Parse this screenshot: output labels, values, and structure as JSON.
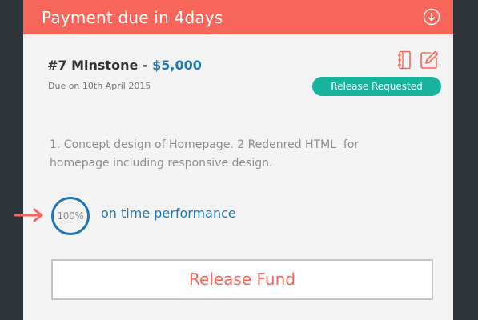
{
  "header": {
    "title": "Payment due in 4days",
    "icon": "download-circle-icon"
  },
  "milestone": {
    "name": "#7 Minstone",
    "separator": " - ",
    "amount": "$5,000",
    "due": "Due on 10th April 2015",
    "status": "Release Requested"
  },
  "icons": {
    "notebook": "notebook-icon",
    "edit": "edit-icon"
  },
  "description": "1. Concept design of Homepage. 2 Redenred HTML  for\nhomepage including responsive design.",
  "performance": {
    "value": "100%",
    "label": "on time performance"
  },
  "actions": {
    "release_label": "Release Fund"
  },
  "colors": {
    "header": "#f8665b",
    "accent_blue": "#2277b1",
    "status_badge": "#18b39c",
    "card_background": "#f3f3f3",
    "page_background": "#2d343a"
  }
}
